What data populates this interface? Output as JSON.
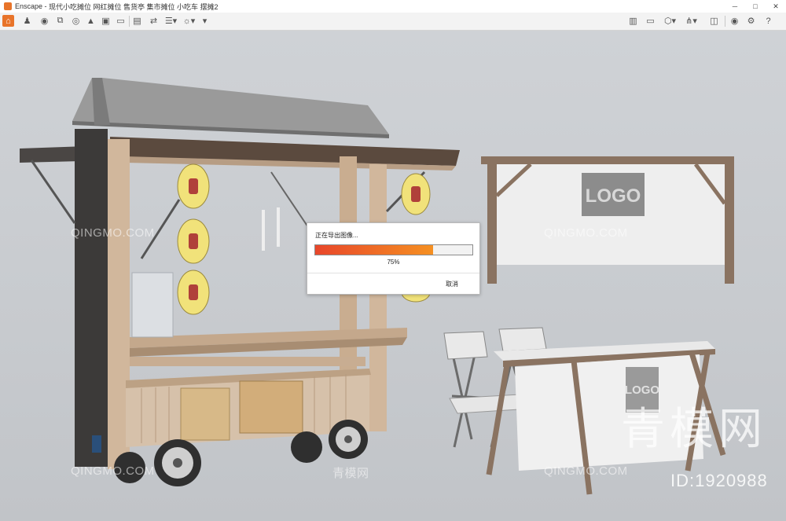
{
  "window": {
    "app_name": "Enscape",
    "separator": " - ",
    "document_title": "现代小吃摊位 网红摊位 售货亭 集市摊位 小吃车 摆摊2"
  },
  "window_controls": [
    {
      "name": "minimize",
      "glyph": "─"
    },
    {
      "name": "maximize",
      "glyph": "□"
    },
    {
      "name": "close",
      "glyph": "✕"
    }
  ],
  "toolbar": {
    "left_icons": [
      "home-icon",
      "walk-icon",
      "screenshot-icon",
      "batch-render-icon",
      "panorama-icon",
      "video-icon",
      "exe-export-icon",
      "web-export-icon",
      "view-management-icon",
      "sync-icon",
      "settings-dropdown-icon",
      "sun-icon",
      "export-dropdown-icon"
    ],
    "right_icons": [
      "map-icon",
      "screen-icon",
      "asset-library-icon",
      "bim-icon",
      "material-icon",
      "eye-icon",
      "gear-icon",
      "help-icon"
    ],
    "accent": "#e8742a"
  },
  "export_dialog": {
    "title": "正在导出图像...",
    "progress": 0.75,
    "progress_text": "75%",
    "cancel_label": "取消"
  },
  "scene": {
    "logo_banner_text": "LOGO",
    "table_cloth_text": "LOGO"
  },
  "watermarks": {
    "site": "QINGMO.COM",
    "chinese_small": "青模网",
    "chinese_big": "青模网",
    "id_text": "ID:1920988"
  }
}
